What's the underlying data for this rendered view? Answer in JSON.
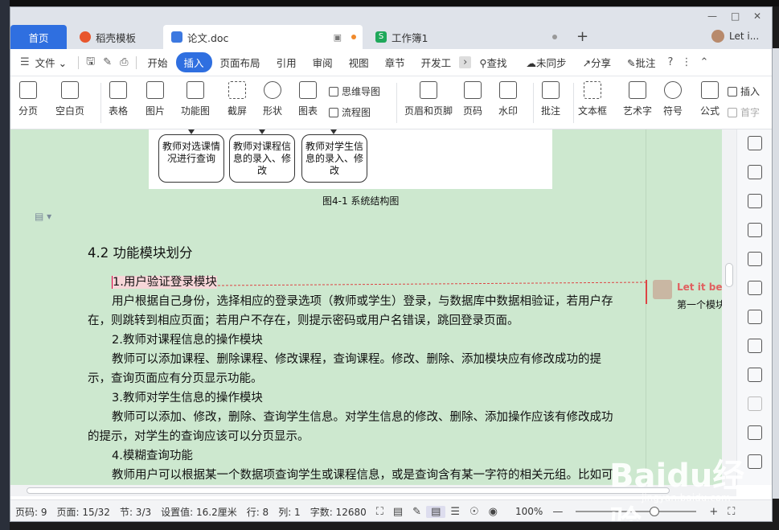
{
  "tabs": {
    "home": "首页",
    "daoke": "稻壳模板",
    "doc": "论文.doc",
    "workbook": "工作簿1",
    "user": "Let i..."
  },
  "menu": {
    "file": "文件",
    "items": [
      "开始",
      "插入",
      "页面布局",
      "引用",
      "审阅",
      "视图",
      "章节",
      "开发工"
    ],
    "find": "查找",
    "sync": "未同步",
    "share": "分享",
    "annotate": "批注"
  },
  "ribbon": {
    "page_break": "分页",
    "blank_page": "空白页",
    "table": "表格",
    "picture": "图片",
    "function_chart": "功能图",
    "screenshot": "截屏",
    "shape": "形状",
    "chart": "图表",
    "mindmap": "思维导图",
    "flowchart": "流程图",
    "header_footer": "页眉和页脚",
    "page_number": "页码",
    "watermark": "水印",
    "comment": "批注",
    "textbox": "文本框",
    "wordart": "艺术字",
    "symbol": "符号",
    "formula": "公式",
    "insert": "插入",
    "dropcap": "首字"
  },
  "document": {
    "figure_boxes": [
      "教师对选课情况进行查询",
      "教师对课程信息的录入、修改",
      "教师对学生信息的录入、修改"
    ],
    "figure_caption": "图4-1 系统结构图",
    "heading": "4.2  功能模块划分",
    "p1_title": "1.用户验证登录模块",
    "p1_body": "用户根据自己身份，选择相应的登录选项（教师或学生）登录，与数据库中数据相验证，若用户存在，则跳转到相应页面；若用户不存在，则提示密码或用户名错误，跳回登录页面。",
    "p2_title": "2.教师对课程信息的操作模块",
    "p2_body": "教师可以添加课程、删除课程、修改课程，查询课程。修改、删除、添加模块应有修改成功的提示，查询页面应有分页显示功能。",
    "p3_title": "3.教师对学生信息的操作模块",
    "p3_body": "教师可以添加、修改，删除、查询学生信息。对学生信息的修改、删除、添加操作应该有修改成功的提示，对学生的查询应该可以分页显示。",
    "p4_title": "4.模糊查询功能",
    "p4_body": "教师用户可以根据某一个数据项查询学生或课程信息，或是查询含有某一字符的相关元组。比如可根据学号、姓名、班级、课程号、或职务等数据项进行查询。"
  },
  "comment": {
    "author": "Let it be",
    "text": "第一个模块"
  },
  "status": {
    "page_code": "页码: 9",
    "page": "页面: 15/32",
    "section": "节: 3/3",
    "setting": "设置值: 16.2厘米",
    "row": "行: 8",
    "col": "列: 1",
    "words": "字数: 12680",
    "zoom": "100%"
  },
  "watermark": {
    "brand": "Baidu经验",
    "url": "jingyan.baidu.com"
  },
  "colors": {
    "accent": "#2f6fe0",
    "page_bg": "#cde8cf",
    "highlight": "#f6d6d8",
    "comment_name": "#e06060"
  }
}
